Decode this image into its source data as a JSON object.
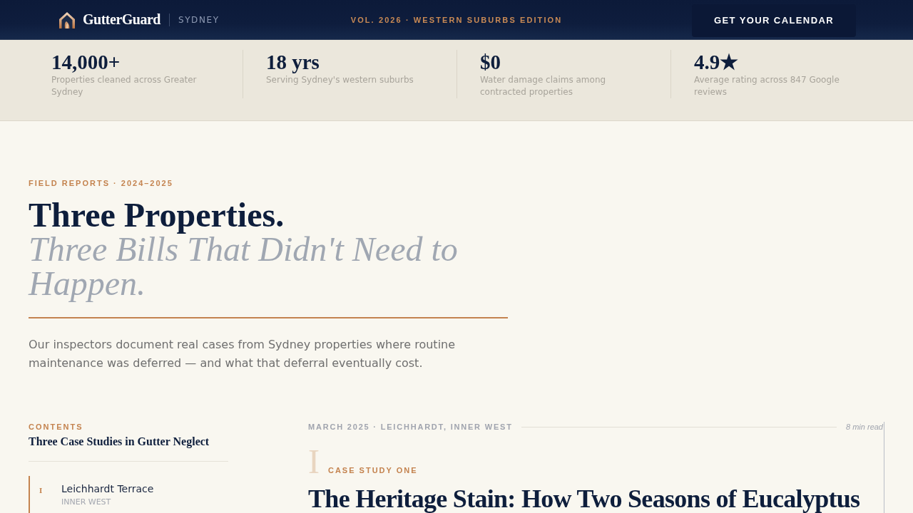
{
  "header": {
    "brand": "GutterGuard",
    "city": "SYDNEY",
    "edition": "VOL. 2026 · WESTERN SUBURBS EDITION",
    "cta": "GET YOUR CALENDAR"
  },
  "stats": [
    {
      "value": "14,000+",
      "label": "Properties cleaned across Greater Sydney"
    },
    {
      "value": "18 yrs",
      "label": "Serving Sydney's western suburbs"
    },
    {
      "value": "$0",
      "label": "Water damage claims among contracted properties"
    },
    {
      "value": "4.9★",
      "label": "Average rating across 847 Google reviews"
    }
  ],
  "hero": {
    "eyebrow": "FIELD REPORTS · 2024–2025",
    "title": "Three Properties.",
    "subtitle": "Three Bills That Didn't Need to Happen.",
    "intro": "Our inspectors document real cases from Sydney properties where routine maintenance was deferred — and what that deferral eventually cost."
  },
  "contents": {
    "eyebrow": "CONTENTS",
    "title": "Three Case Studies in Gutter Neglect",
    "items": [
      {
        "numeral": "I",
        "name": "Leichhardt Terrace",
        "region": "INNER WEST",
        "selected": true
      }
    ]
  },
  "article": {
    "meta": "MARCH 2025 · LEICHHARDT, INNER WEST",
    "read_time": "8 min read",
    "numeral": "I",
    "kicker": "CASE STUDY ONE",
    "headline": "The Heritage Stain: How Two Seasons of Eucalyptus"
  }
}
